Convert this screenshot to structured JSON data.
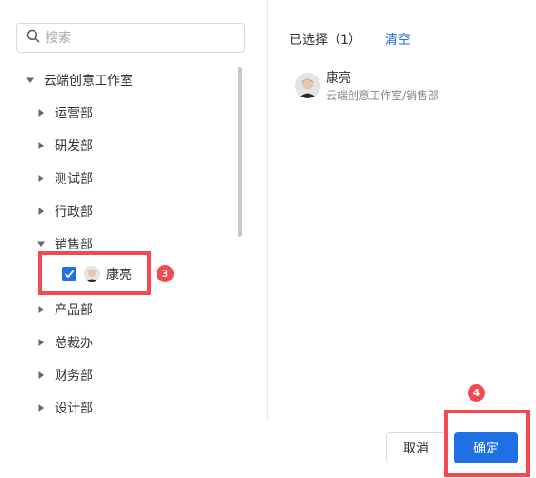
{
  "search": {
    "placeholder": "搜索",
    "icon": "search-icon"
  },
  "tree": {
    "root": {
      "label": "云端创意工作室",
      "expanded": true
    },
    "departments": [
      {
        "label": "运营部",
        "expanded": false
      },
      {
        "label": "研发部",
        "expanded": false
      },
      {
        "label": "测试部",
        "expanded": false
      },
      {
        "label": "行政部",
        "expanded": false
      },
      {
        "label": "销售部",
        "expanded": true
      },
      {
        "label": "产品部",
        "expanded": false
      },
      {
        "label": "总裁办",
        "expanded": false
      },
      {
        "label": "财务部",
        "expanded": false
      },
      {
        "label": "设计部",
        "expanded": false
      }
    ],
    "member": {
      "name": "康亮",
      "checked": true
    }
  },
  "selected": {
    "header": "已选择（1）",
    "clear_label": "清空",
    "items": [
      {
        "name": "康亮",
        "path": "云端创意工作室/销售部"
      }
    ]
  },
  "annotations": {
    "step3": "3",
    "step4": "4"
  },
  "footer": {
    "cancel_label": "取消",
    "confirm_label": "确定"
  },
  "colors": {
    "primary": "#1f6fe5",
    "annotation": "#f44a4f",
    "text": "#333333",
    "muted": "#8a8a8a"
  }
}
